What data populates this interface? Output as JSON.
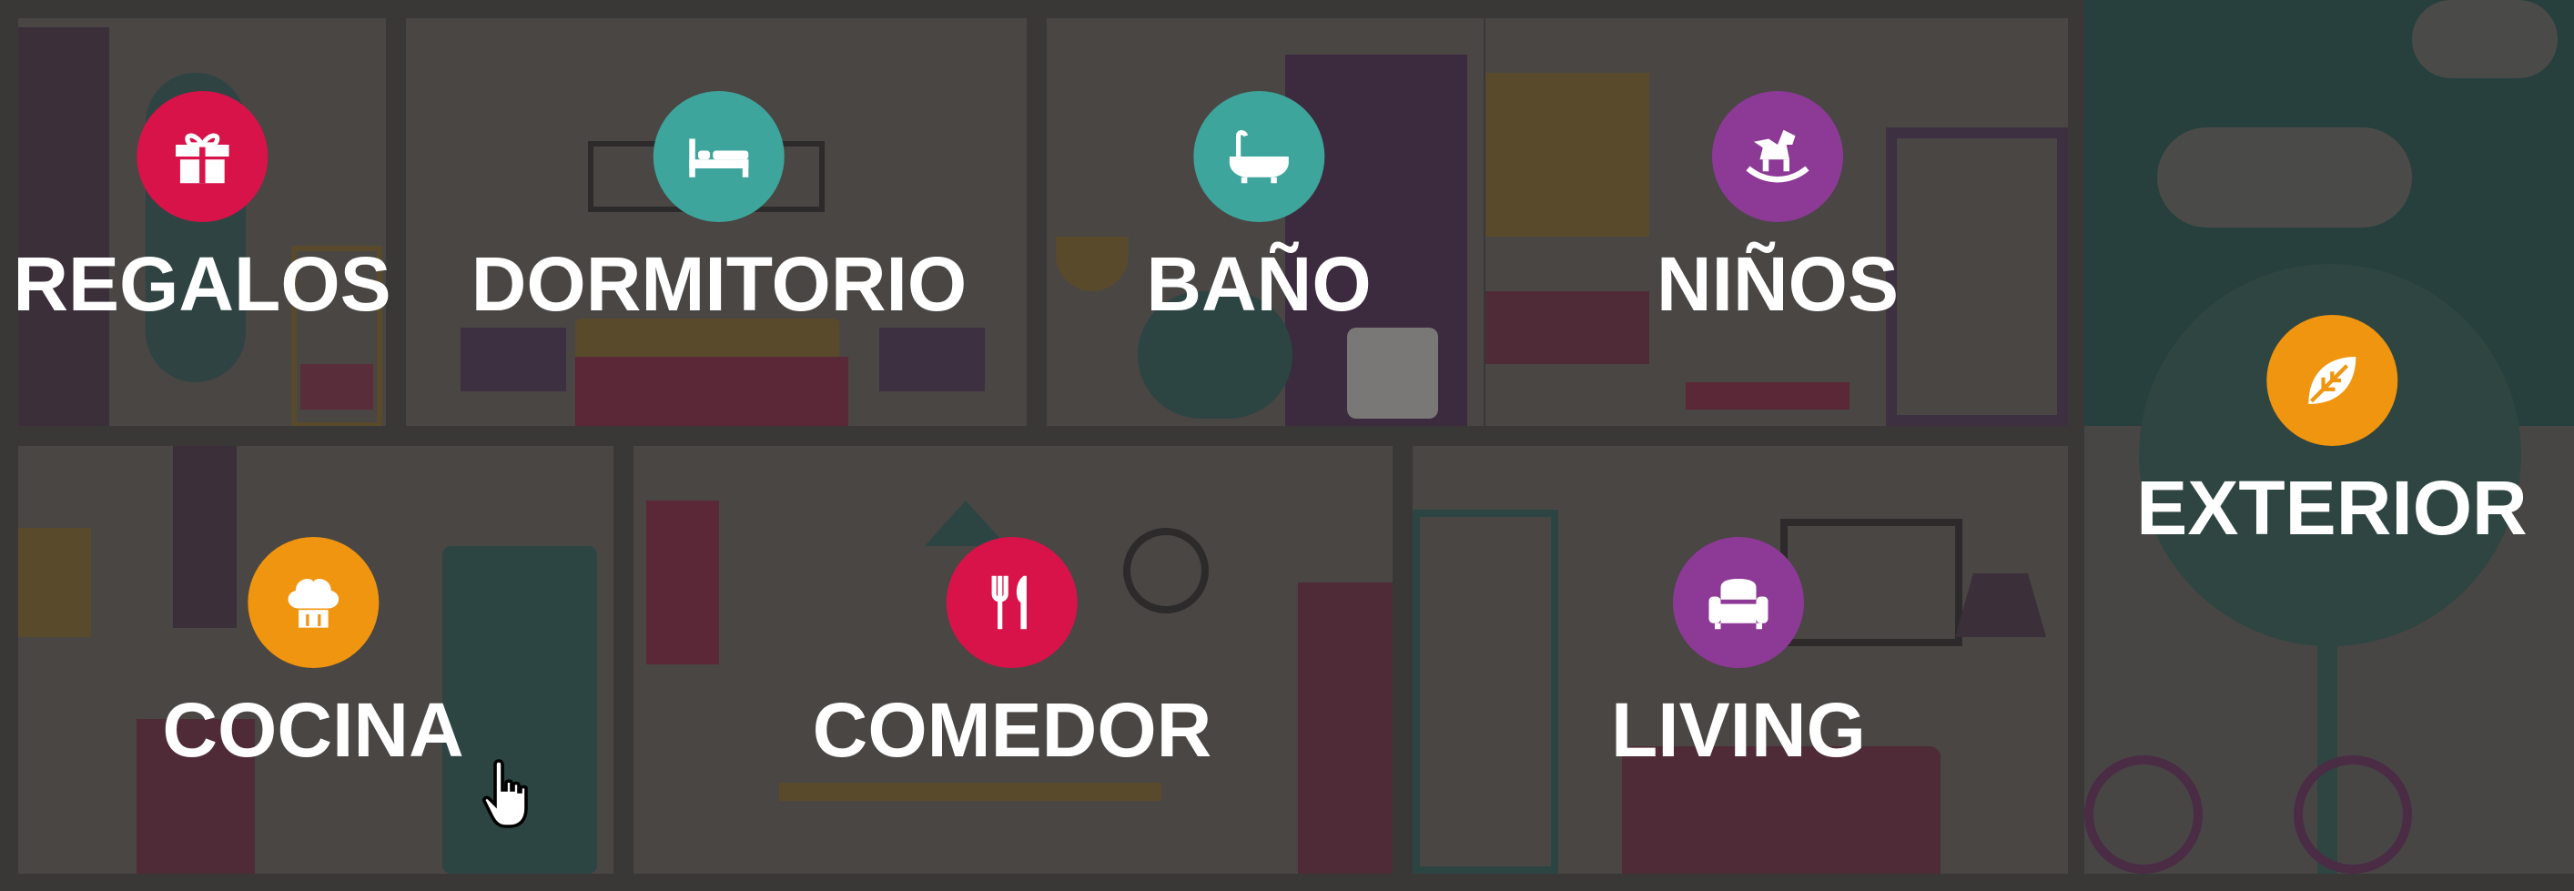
{
  "colors": {
    "wall": "#494644",
    "frame": "#3a3837",
    "red": "#d7134a",
    "teal": "#3ea59c",
    "purple": "#8d3a97",
    "orange": "#f0950f",
    "label": "#ffffff",
    "exterior_sky": "#27403d"
  },
  "categories": [
    {
      "label": "REGALOS",
      "icon": "gift-icon",
      "color": "#d7134a"
    },
    {
      "label": "DORMITORIO",
      "icon": "bed-icon",
      "color": "#3ea59c"
    },
    {
      "label": "BAÑO",
      "icon": "bathtub-icon",
      "color": "#3ea59c"
    },
    {
      "label": "NIÑOS",
      "icon": "rocking-horse-icon",
      "color": "#8d3a97"
    },
    {
      "label": "EXTERIOR",
      "icon": "leaf-icon",
      "color": "#f0950f"
    },
    {
      "label": "COCINA",
      "icon": "chef-hat-icon",
      "color": "#f0950f"
    },
    {
      "label": "COMEDOR",
      "icon": "fork-knife-icon",
      "color": "#d7134a"
    },
    {
      "label": "LIVING",
      "icon": "armchair-icon",
      "color": "#8d3a97"
    }
  ]
}
